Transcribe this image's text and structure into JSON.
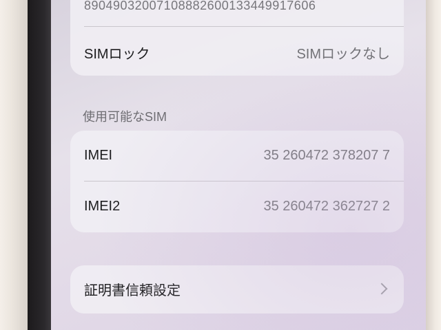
{
  "sim_card": {
    "iccid_value": "89049032007108882600133449917606",
    "sim_lock_label": "SIMロック",
    "sim_lock_value": "SIMロックなし"
  },
  "available_sim": {
    "header": "使用可能なSIM",
    "imei_label": "IMEI",
    "imei_value": "35 260472 378207 7",
    "imei2_label": "IMEI2",
    "imei2_value": "35 260472 362727 2"
  },
  "certificate": {
    "label": "証明書信頼設定",
    "chevron_icon": "chevron-right-icon"
  }
}
